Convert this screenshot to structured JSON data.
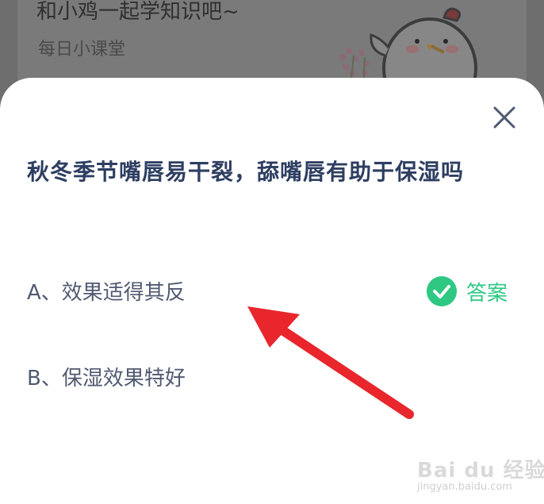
{
  "banner": {
    "title": "和小鸡一起学知识吧~",
    "subtitle": "每日小课堂"
  },
  "quiz": {
    "question": "秋冬季节嘴唇易干裂，舔嘴唇有助于保湿吗",
    "options": [
      {
        "label": "A、效果适得其反",
        "is_answer": true
      },
      {
        "label": "B、保湿效果特好",
        "is_answer": false
      }
    ],
    "answer_label": "答案"
  },
  "icons": {
    "close": "close-icon",
    "check": "check-circle-icon",
    "mascot": "chicken-mascot-icon"
  },
  "watermark": {
    "brand": "Bai du 经验",
    "url": "jingyan.baidu.com"
  },
  "colors": {
    "accent_green": "#2fc883",
    "question_text": "#2e3e62",
    "option_text": "#505a70",
    "annotation_red": "#e8262c"
  }
}
